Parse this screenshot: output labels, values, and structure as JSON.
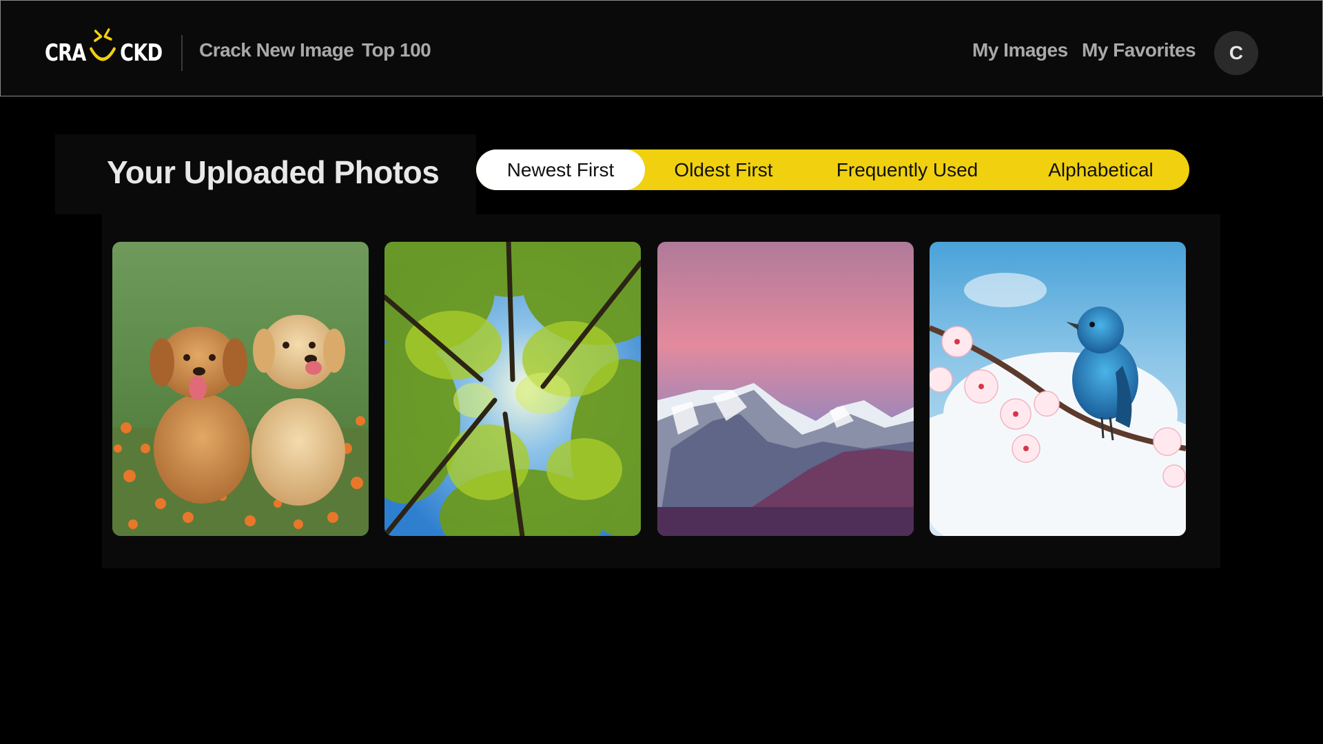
{
  "app": {
    "logo_text_left": "CRA",
    "logo_text_right": "CKD",
    "brand_color": "#f0d00f"
  },
  "nav": {
    "left_links": [
      "Crack New Image",
      "Top 100"
    ],
    "right_links": [
      "My Images",
      "My Favorites"
    ],
    "avatar_initial": "C"
  },
  "page": {
    "title": "Your Uploaded Photos"
  },
  "sort": {
    "options": [
      "Newest First",
      "Oldest First",
      "Frequently Used",
      "Alphabetical"
    ],
    "selected": "Newest First"
  },
  "gallery": {
    "photos": [
      {
        "subject": "golden-retriever-puppies"
      },
      {
        "subject": "forest-canopy"
      },
      {
        "subject": "snowy-mountains-pink-sky"
      },
      {
        "subject": "blue-bird-blossom-branch"
      }
    ]
  }
}
